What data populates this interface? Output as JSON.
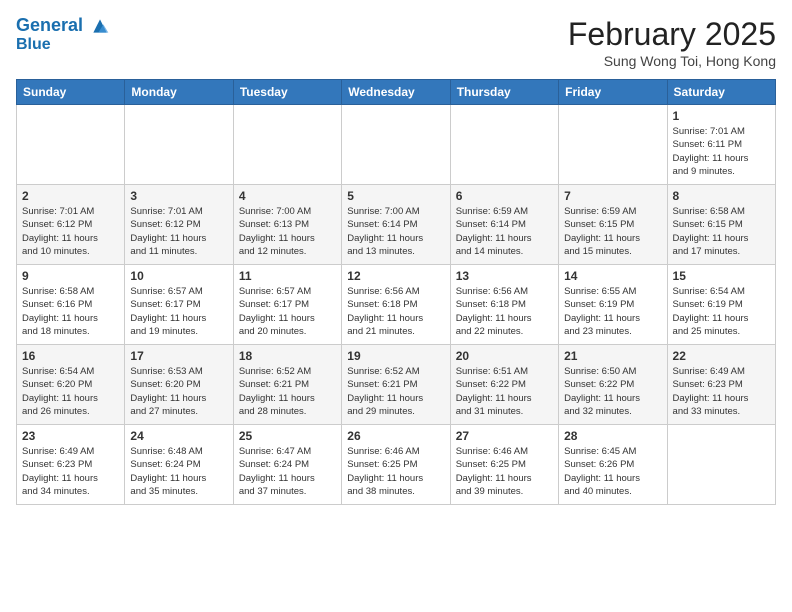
{
  "header": {
    "logo_line1": "General",
    "logo_line2": "Blue",
    "month": "February 2025",
    "location": "Sung Wong Toi, Hong Kong"
  },
  "weekdays": [
    "Sunday",
    "Monday",
    "Tuesday",
    "Wednesday",
    "Thursday",
    "Friday",
    "Saturday"
  ],
  "weeks": [
    [
      {
        "day": "",
        "info": ""
      },
      {
        "day": "",
        "info": ""
      },
      {
        "day": "",
        "info": ""
      },
      {
        "day": "",
        "info": ""
      },
      {
        "day": "",
        "info": ""
      },
      {
        "day": "",
        "info": ""
      },
      {
        "day": "1",
        "info": "Sunrise: 7:01 AM\nSunset: 6:11 PM\nDaylight: 11 hours\nand 9 minutes."
      }
    ],
    [
      {
        "day": "2",
        "info": "Sunrise: 7:01 AM\nSunset: 6:12 PM\nDaylight: 11 hours\nand 10 minutes."
      },
      {
        "day": "3",
        "info": "Sunrise: 7:01 AM\nSunset: 6:12 PM\nDaylight: 11 hours\nand 11 minutes."
      },
      {
        "day": "4",
        "info": "Sunrise: 7:00 AM\nSunset: 6:13 PM\nDaylight: 11 hours\nand 12 minutes."
      },
      {
        "day": "5",
        "info": "Sunrise: 7:00 AM\nSunset: 6:14 PM\nDaylight: 11 hours\nand 13 minutes."
      },
      {
        "day": "6",
        "info": "Sunrise: 6:59 AM\nSunset: 6:14 PM\nDaylight: 11 hours\nand 14 minutes."
      },
      {
        "day": "7",
        "info": "Sunrise: 6:59 AM\nSunset: 6:15 PM\nDaylight: 11 hours\nand 15 minutes."
      },
      {
        "day": "8",
        "info": "Sunrise: 6:58 AM\nSunset: 6:15 PM\nDaylight: 11 hours\nand 17 minutes."
      }
    ],
    [
      {
        "day": "9",
        "info": "Sunrise: 6:58 AM\nSunset: 6:16 PM\nDaylight: 11 hours\nand 18 minutes."
      },
      {
        "day": "10",
        "info": "Sunrise: 6:57 AM\nSunset: 6:17 PM\nDaylight: 11 hours\nand 19 minutes."
      },
      {
        "day": "11",
        "info": "Sunrise: 6:57 AM\nSunset: 6:17 PM\nDaylight: 11 hours\nand 20 minutes."
      },
      {
        "day": "12",
        "info": "Sunrise: 6:56 AM\nSunset: 6:18 PM\nDaylight: 11 hours\nand 21 minutes."
      },
      {
        "day": "13",
        "info": "Sunrise: 6:56 AM\nSunset: 6:18 PM\nDaylight: 11 hours\nand 22 minutes."
      },
      {
        "day": "14",
        "info": "Sunrise: 6:55 AM\nSunset: 6:19 PM\nDaylight: 11 hours\nand 23 minutes."
      },
      {
        "day": "15",
        "info": "Sunrise: 6:54 AM\nSunset: 6:19 PM\nDaylight: 11 hours\nand 25 minutes."
      }
    ],
    [
      {
        "day": "16",
        "info": "Sunrise: 6:54 AM\nSunset: 6:20 PM\nDaylight: 11 hours\nand 26 minutes."
      },
      {
        "day": "17",
        "info": "Sunrise: 6:53 AM\nSunset: 6:20 PM\nDaylight: 11 hours\nand 27 minutes."
      },
      {
        "day": "18",
        "info": "Sunrise: 6:52 AM\nSunset: 6:21 PM\nDaylight: 11 hours\nand 28 minutes."
      },
      {
        "day": "19",
        "info": "Sunrise: 6:52 AM\nSunset: 6:21 PM\nDaylight: 11 hours\nand 29 minutes."
      },
      {
        "day": "20",
        "info": "Sunrise: 6:51 AM\nSunset: 6:22 PM\nDaylight: 11 hours\nand 31 minutes."
      },
      {
        "day": "21",
        "info": "Sunrise: 6:50 AM\nSunset: 6:22 PM\nDaylight: 11 hours\nand 32 minutes."
      },
      {
        "day": "22",
        "info": "Sunrise: 6:49 AM\nSunset: 6:23 PM\nDaylight: 11 hours\nand 33 minutes."
      }
    ],
    [
      {
        "day": "23",
        "info": "Sunrise: 6:49 AM\nSunset: 6:23 PM\nDaylight: 11 hours\nand 34 minutes."
      },
      {
        "day": "24",
        "info": "Sunrise: 6:48 AM\nSunset: 6:24 PM\nDaylight: 11 hours\nand 35 minutes."
      },
      {
        "day": "25",
        "info": "Sunrise: 6:47 AM\nSunset: 6:24 PM\nDaylight: 11 hours\nand 37 minutes."
      },
      {
        "day": "26",
        "info": "Sunrise: 6:46 AM\nSunset: 6:25 PM\nDaylight: 11 hours\nand 38 minutes."
      },
      {
        "day": "27",
        "info": "Sunrise: 6:46 AM\nSunset: 6:25 PM\nDaylight: 11 hours\nand 39 minutes."
      },
      {
        "day": "28",
        "info": "Sunrise: 6:45 AM\nSunset: 6:26 PM\nDaylight: 11 hours\nand 40 minutes."
      },
      {
        "day": "",
        "info": ""
      }
    ]
  ]
}
